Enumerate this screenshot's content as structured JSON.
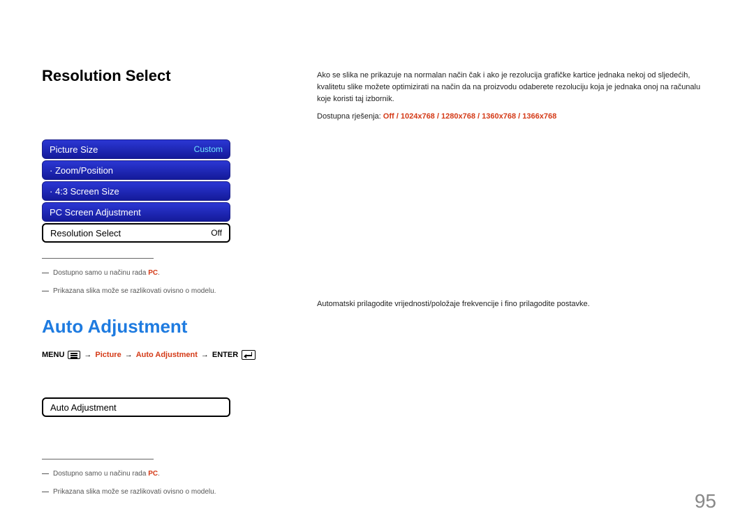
{
  "section1": {
    "title": "Resolution Select",
    "right": {
      "paragraph": "Ako se slika ne prikazuje na normalan način čak i ako je rezolucija grafičke kartice jednaka nekoj od sljedećih, kvalitetu slike možete optimizirati na način da na proizvodu odaberete rezoluciju koja je jednaka onoj na računalu koje koristi taj izbornik.",
      "resolutions_label": "Dostupna rješenja: ",
      "resolutions": [
        "Off",
        "1024x768",
        "1280x768",
        "1360x768",
        "1366x768"
      ]
    },
    "menu": {
      "rows": [
        {
          "label": "Picture Size",
          "value": "Custom",
          "style": "blue"
        },
        {
          "label": "· Zoom/Position",
          "value": "",
          "style": "blue"
        },
        {
          "label": "· 4:3 Screen Size",
          "value": "",
          "style": "blue"
        },
        {
          "label": "PC Screen Adjustment",
          "value": "",
          "style": "blue"
        },
        {
          "label": "Resolution Select",
          "value": "Off",
          "style": "white"
        }
      ]
    },
    "footnotes": [
      {
        "text": "Dostupno samo u načinu rada ",
        "suffix": "PC",
        "suffix_hl": true,
        "period": "."
      },
      {
        "text": "Prikazana slika može se razlikovati ovisno o modelu.",
        "suffix": "",
        "suffix_hl": false,
        "period": ""
      }
    ]
  },
  "section2": {
    "title": "Auto Adjustment",
    "right": {
      "paragraph": "Automatski prilagodite vrijednosti/položaje frekvencije i fino prilagodite postavke."
    },
    "breadcrumb": {
      "menu": "MENU",
      "picture": "Picture",
      "auto": "Auto Adjustment",
      "enter": "ENTER"
    },
    "menu": {
      "rows": [
        {
          "label": "Auto Adjustment",
          "value": "",
          "style": "white"
        }
      ]
    },
    "footnotes": [
      {
        "text": "Dostupno samo u načinu rada ",
        "suffix": "PC",
        "suffix_hl": true,
        "period": "."
      },
      {
        "text": "Prikazana slika može se razlikovati ovisno o modelu.",
        "suffix": "",
        "suffix_hl": false,
        "period": ""
      }
    ]
  },
  "page_number": "95"
}
